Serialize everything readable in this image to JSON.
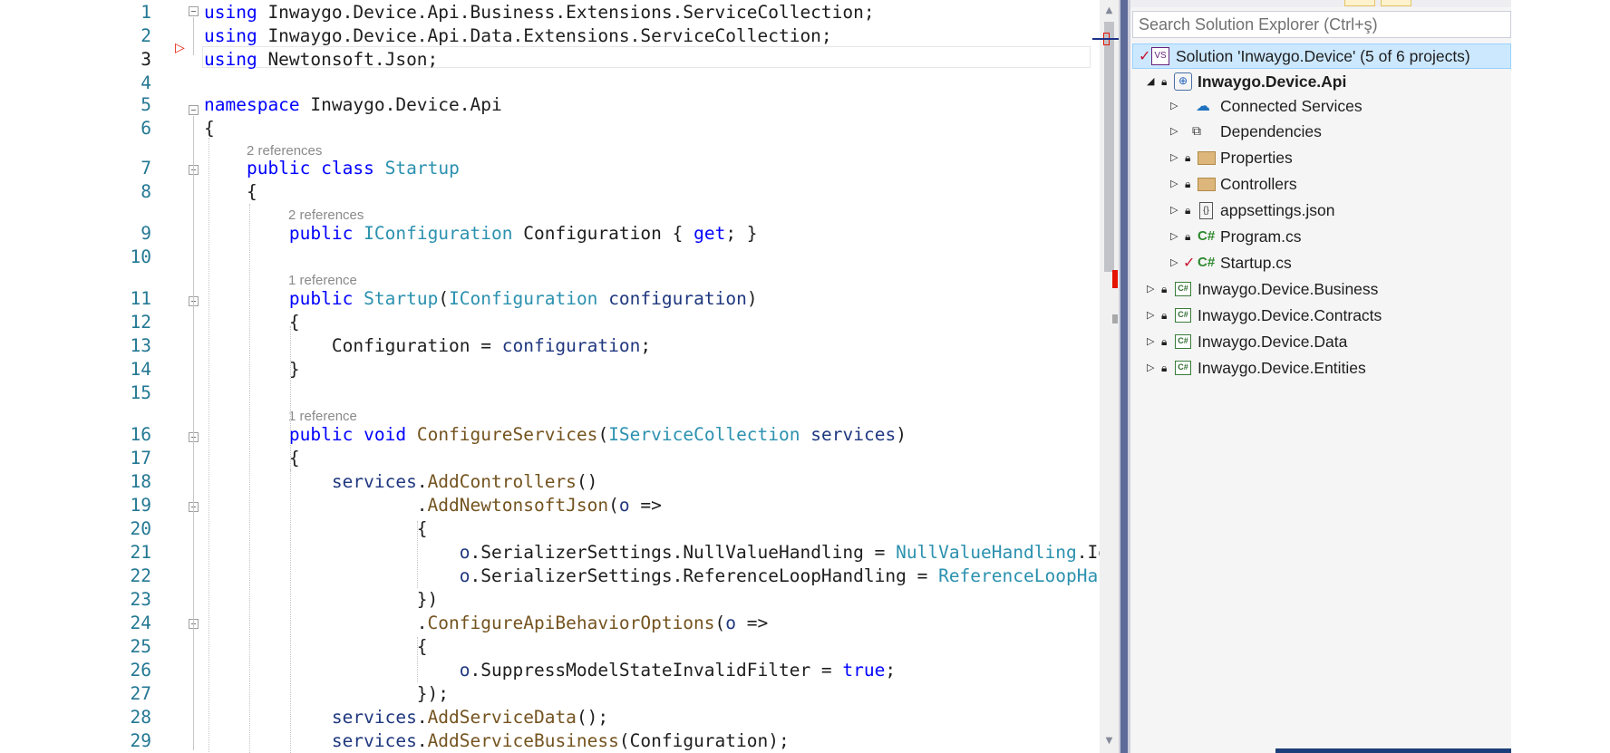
{
  "editor": {
    "lines": [
      {
        "n": "1",
        "tokens": [
          {
            "t": "using",
            "c": "kw"
          },
          {
            "t": " Inwaygo.Device.Api.Business.Extensions.ServiceCollection;"
          }
        ]
      },
      {
        "n": "2",
        "tokens": [
          {
            "t": "using",
            "c": "kw"
          },
          {
            "t": " Inwaygo.Device.Api.Data.Extensions.ServiceCollection;"
          }
        ]
      },
      {
        "n": "3",
        "tokens": [
          {
            "t": "using",
            "c": "kw"
          },
          {
            "t": " Newtonsoft.Json;"
          }
        ]
      },
      {
        "n": "4",
        "tokens": []
      },
      {
        "n": "5",
        "tokens": [
          {
            "t": "namespace",
            "c": "kw"
          },
          {
            "t": " Inwaygo.Device.Api"
          }
        ]
      },
      {
        "n": "6",
        "tokens": [
          {
            "t": "{"
          }
        ]
      },
      {
        "n": "7",
        "tokens": [
          {
            "t": "    "
          },
          {
            "t": "public",
            "c": "kw"
          },
          {
            "t": " "
          },
          {
            "t": "class",
            "c": "kw"
          },
          {
            "t": " "
          },
          {
            "t": "Startup",
            "c": "ty"
          }
        ]
      },
      {
        "n": "8",
        "tokens": [
          {
            "t": "    {"
          }
        ]
      },
      {
        "n": "9",
        "tokens": [
          {
            "t": "        "
          },
          {
            "t": "public",
            "c": "kw"
          },
          {
            "t": " "
          },
          {
            "t": "IConfiguration",
            "c": "ty"
          },
          {
            "t": " Configuration { "
          },
          {
            "t": "get",
            "c": "kw"
          },
          {
            "t": "; }"
          }
        ]
      },
      {
        "n": "10",
        "tokens": []
      },
      {
        "n": "11",
        "tokens": [
          {
            "t": "        "
          },
          {
            "t": "public",
            "c": "kw"
          },
          {
            "t": " "
          },
          {
            "t": "Startup",
            "c": "ty"
          },
          {
            "t": "("
          },
          {
            "t": "IConfiguration",
            "c": "ty"
          },
          {
            "t": " "
          },
          {
            "t": "configuration",
            "c": "pm"
          },
          {
            "t": ")"
          }
        ]
      },
      {
        "n": "12",
        "tokens": [
          {
            "t": "        {"
          }
        ]
      },
      {
        "n": "13",
        "tokens": [
          {
            "t": "            Configuration = "
          },
          {
            "t": "configuration",
            "c": "pm"
          },
          {
            "t": ";"
          }
        ]
      },
      {
        "n": "14",
        "tokens": [
          {
            "t": "        }"
          }
        ]
      },
      {
        "n": "15",
        "tokens": []
      },
      {
        "n": "16",
        "tokens": [
          {
            "t": "        "
          },
          {
            "t": "public",
            "c": "kw"
          },
          {
            "t": " "
          },
          {
            "t": "void",
            "c": "kw"
          },
          {
            "t": " "
          },
          {
            "t": "ConfigureServices",
            "c": "mt"
          },
          {
            "t": "("
          },
          {
            "t": "IServiceCollection",
            "c": "ty"
          },
          {
            "t": " "
          },
          {
            "t": "services",
            "c": "pm"
          },
          {
            "t": ")"
          }
        ]
      },
      {
        "n": "17",
        "tokens": [
          {
            "t": "        {"
          }
        ]
      },
      {
        "n": "18",
        "tokens": [
          {
            "t": "            "
          },
          {
            "t": "services",
            "c": "pm"
          },
          {
            "t": "."
          },
          {
            "t": "AddControllers",
            "c": "mt"
          },
          {
            "t": "()"
          }
        ]
      },
      {
        "n": "19",
        "tokens": [
          {
            "t": "                    ."
          },
          {
            "t": "AddNewtonsoftJson",
            "c": "mt"
          },
          {
            "t": "("
          },
          {
            "t": "o",
            "c": "pm"
          },
          {
            "t": " =>"
          }
        ]
      },
      {
        "n": "20",
        "tokens": [
          {
            "t": "                    {"
          }
        ]
      },
      {
        "n": "21",
        "tokens": [
          {
            "t": "                        "
          },
          {
            "t": "o",
            "c": "pm"
          },
          {
            "t": ".SerializerSettings.NullValueHandling = "
          },
          {
            "t": "NullValueHandling",
            "c": "ty"
          },
          {
            "t": ".Ig"
          }
        ]
      },
      {
        "n": "22",
        "tokens": [
          {
            "t": "                        "
          },
          {
            "t": "o",
            "c": "pm"
          },
          {
            "t": ".SerializerSettings.ReferenceLoopHandling = "
          },
          {
            "t": "ReferenceLoopHan",
            "c": "ty"
          }
        ]
      },
      {
        "n": "23",
        "tokens": [
          {
            "t": "                    })"
          }
        ]
      },
      {
        "n": "24",
        "tokens": [
          {
            "t": "                    ."
          },
          {
            "t": "ConfigureApiBehaviorOptions",
            "c": "mt"
          },
          {
            "t": "("
          },
          {
            "t": "o",
            "c": "pm"
          },
          {
            "t": " =>"
          }
        ]
      },
      {
        "n": "25",
        "tokens": [
          {
            "t": "                    {"
          }
        ]
      },
      {
        "n": "26",
        "tokens": [
          {
            "t": "                        "
          },
          {
            "t": "o",
            "c": "pm"
          },
          {
            "t": ".SuppressModelStateInvalidFilter = "
          },
          {
            "t": "true",
            "c": "kw"
          },
          {
            "t": ";"
          }
        ]
      },
      {
        "n": "27",
        "tokens": [
          {
            "t": "                    });"
          }
        ]
      },
      {
        "n": "28",
        "tokens": [
          {
            "t": "            "
          },
          {
            "t": "services",
            "c": "pm"
          },
          {
            "t": "."
          },
          {
            "t": "AddServiceData",
            "c": "mt"
          },
          {
            "t": "();"
          }
        ]
      },
      {
        "n": "29",
        "tokens": [
          {
            "t": "            "
          },
          {
            "t": "services",
            "c": "pm"
          },
          {
            "t": "."
          },
          {
            "t": "AddServiceBusiness",
            "c": "mt"
          },
          {
            "t": "(Configuration);"
          }
        ]
      }
    ],
    "codelens": [
      {
        "before_line": 7,
        "text": "2 references"
      },
      {
        "before_line": 9,
        "text": "2 references"
      },
      {
        "before_line": 11,
        "text": "1 reference"
      },
      {
        "before_line": 16,
        "text": "1 reference"
      }
    ],
    "active_line": "3",
    "colors": {
      "keyword": "#0000ff",
      "type": "#2b91af",
      "method": "#74531f",
      "parameter": "#1f377f",
      "line_number": "#237893"
    }
  },
  "solution_explorer": {
    "search_placeholder": "Search Solution Explorer (Ctrl+ş)",
    "solution_label": "Solution 'Inwaygo.Device' (5 of 6 projects)",
    "items": [
      {
        "label": "Inwaygo.Device.Api",
        "icon": "web-project-icon",
        "expanded": true,
        "bold": true
      },
      {
        "label": "Connected Services",
        "icon": "connected-services-icon"
      },
      {
        "label": "Dependencies",
        "icon": "dependencies-icon"
      },
      {
        "label": "Properties",
        "icon": "properties-folder-icon",
        "locked": true
      },
      {
        "label": "Controllers",
        "icon": "folder-icon",
        "locked": true
      },
      {
        "label": "appsettings.json",
        "icon": "json-file-icon",
        "locked": true
      },
      {
        "label": "Program.cs",
        "icon": "csharp-file-icon",
        "locked": true
      },
      {
        "label": "Startup.cs",
        "icon": "csharp-file-icon",
        "checked": true
      },
      {
        "label": "Inwaygo.Device.Business",
        "icon": "csharp-project-icon",
        "locked": true
      },
      {
        "label": "Inwaygo.Device.Contracts",
        "icon": "csharp-project-icon",
        "locked": true
      },
      {
        "label": "Inwaygo.Device.Data",
        "icon": "csharp-project-icon",
        "locked": true
      },
      {
        "label": "Inwaygo.Device.Entities",
        "icon": "csharp-project-icon",
        "locked": true
      }
    ],
    "icon_glyphs": {
      "lock": "🔒︎",
      "check": "✓",
      "expand": "▷",
      "collapse": "◢",
      "cs": "C#"
    }
  }
}
